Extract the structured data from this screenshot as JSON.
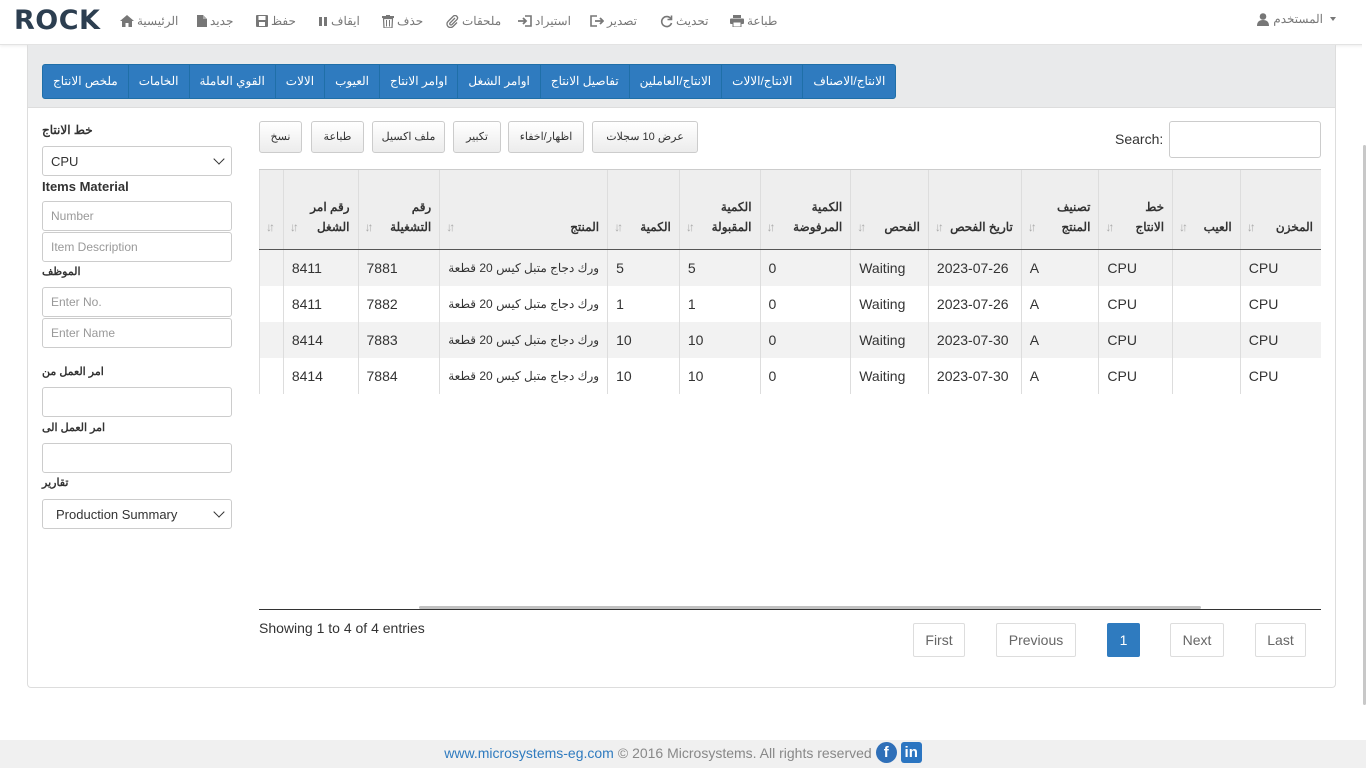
{
  "navbar": {
    "brand": "ROCK",
    "items": [
      {
        "label": "الرئيسية",
        "icon": "home-icon"
      },
      {
        "label": "جديد",
        "icon": "new-file-icon"
      },
      {
        "label": "حفظ",
        "icon": "save-icon"
      },
      {
        "label": "ايقاف",
        "icon": "pause-icon"
      },
      {
        "label": "حذف",
        "icon": "trash-icon"
      },
      {
        "label": "ملحقات",
        "icon": "paperclip-icon"
      },
      {
        "label": "استيراد",
        "icon": "import-icon"
      },
      {
        "label": "تصدير",
        "icon": "export-icon"
      },
      {
        "label": "تحديث",
        "icon": "refresh-icon"
      },
      {
        "label": "طباعة",
        "icon": "print-icon"
      }
    ],
    "user_label": "المستخدم"
  },
  "tabs": [
    "الانتاج/الاصناف",
    "الانتاج/الالات",
    "الانتاج/العاملين",
    "تفاصيل الانتاج",
    "اوامر الشغل",
    "اوامر الانتاج",
    "العيوب",
    "الالات",
    "القوي العاملة",
    "الخامات",
    "ملخص الانتاج"
  ],
  "sidebar": {
    "production_line_label": "خط الانتاج",
    "production_line_value": "CPU",
    "items_material_label": "Items Material",
    "number_placeholder": "Number",
    "item_description_placeholder": "Item Description",
    "employee_label": "الموظف",
    "enter_no_placeholder": "Enter No.",
    "enter_name_placeholder": "Enter Name",
    "work_order_from_label": "امر العمل من",
    "work_order_to_label": "امر العمل الى",
    "reports_label": "تقارير",
    "reports_value": "Production Summary"
  },
  "toolbar": {
    "copy": "نسخ",
    "print": "طباعة",
    "excel": "ملف اكسيل",
    "zoom": "تكبير",
    "show_hide": "اظهار/اخفاء",
    "show_records": "عرض 10 سجلات",
    "search_label": "Search:"
  },
  "table": {
    "headers": [
      "",
      "رقم امر الشغل",
      "رقم التشغيلة",
      "المنتج",
      "الكمية",
      "الكمية المقبولة",
      "الكمية المرفوضة",
      "الفحص",
      "تاريخ الفحص",
      "تصنيف المنتج",
      "خط الانتاج",
      "العيب",
      "المخزن"
    ],
    "rows": [
      [
        "",
        "8411",
        "7881",
        "ورك دجاج متبل كيس 20 قطعة",
        "5",
        "5",
        "0",
        "Waiting",
        "2023-07-26",
        "A",
        "CPU",
        "",
        "CPU"
      ],
      [
        "",
        "8411",
        "7882",
        "ورك دجاج متبل كيس 20 قطعة",
        "1",
        "1",
        "0",
        "Waiting",
        "2023-07-26",
        "A",
        "CPU",
        "",
        "CPU"
      ],
      [
        "",
        "8414",
        "7883",
        "ورك دجاج متبل كيس 20 قطعة",
        "10",
        "10",
        "0",
        "Waiting",
        "2023-07-30",
        "A",
        "CPU",
        "",
        "CPU"
      ],
      [
        "",
        "8414",
        "7884",
        "ورك دجاج متبل كيس 20 قطعة",
        "10",
        "10",
        "0",
        "Waiting",
        "2023-07-30",
        "A",
        "CPU",
        "",
        "CPU"
      ]
    ]
  },
  "info": "Showing 1 to 4 of 4 entries",
  "pagination": {
    "first": "First",
    "previous": "Previous",
    "current": "1",
    "next": "Next",
    "last": "Last"
  },
  "footer": {
    "link": "www.microsystems-eg.com",
    "text": "© 2016 Microsystems. All rights reserved"
  },
  "colors": {
    "primary": "#2f7bbf",
    "brand": "#2c3e50"
  }
}
